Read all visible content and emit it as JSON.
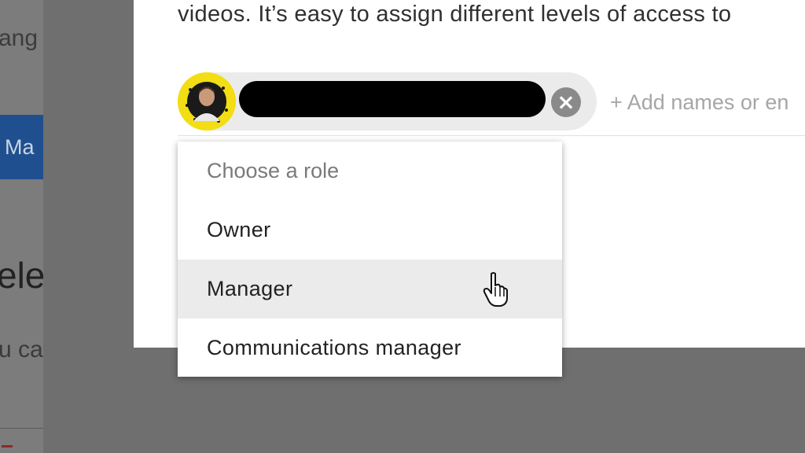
{
  "background": {
    "text_top": "ang",
    "button_label": "Ma",
    "heading": "ele",
    "text_bottom": "u ca"
  },
  "dialog": {
    "intro_text": "videos. It’s easy to assign different levels of access to",
    "recipient_chip": {
      "avatar_icon": "user-avatar",
      "remove_icon": "close-circle-icon"
    },
    "add_placeholder": "+ Add names or en"
  },
  "role_menu": {
    "header": "Choose a role",
    "items": [
      {
        "label": "Owner"
      },
      {
        "label": "Manager",
        "hovered": true
      },
      {
        "label": "Communications manager"
      }
    ]
  },
  "colors": {
    "overlay": "#6f6f6f",
    "chip_bg": "#ebebeb",
    "hover_bg": "#ebebeb",
    "avatar_bg": "#f3dd14",
    "bg_button": "#1f4f8f"
  }
}
